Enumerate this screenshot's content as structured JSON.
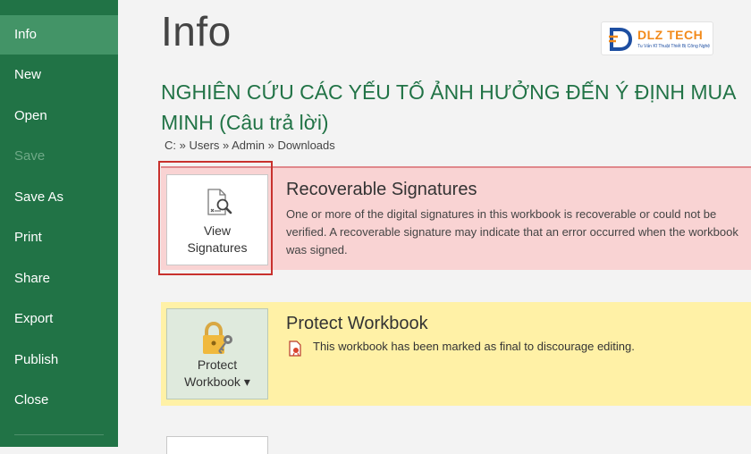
{
  "sidebar": {
    "items": [
      {
        "label": "Info"
      },
      {
        "label": "New"
      },
      {
        "label": "Open"
      },
      {
        "label": "Save"
      },
      {
        "label": "Save As"
      },
      {
        "label": "Print"
      },
      {
        "label": "Share"
      },
      {
        "label": "Export"
      },
      {
        "label": "Publish"
      },
      {
        "label": "Close"
      }
    ],
    "active_index": 0
  },
  "main": {
    "title": "Info",
    "document_title": "NGHIÊN CỨU CÁC YẾU TỐ ẢNH HƯỞNG ĐẾN Ý ĐỊNH MUA MINH (Câu trả lời)",
    "breadcrumb": "C: » Users » Admin » Downloads"
  },
  "logo": {
    "text": "DLZ TECH",
    "tagline": "Tu Vấn Kĩ Thuật Thiết Bị Công Nghệ"
  },
  "signatures_card": {
    "button_line1": "View",
    "button_line2": "Signatures",
    "heading": "Recoverable Signatures",
    "description": "One or more of the digital signatures in this workbook is recoverable or could not be verified. A recoverable signature may indicate that an error occurred when the workbook was signed."
  },
  "protect_card": {
    "button_line1": "Protect",
    "button_line2": "Workbook ▾",
    "heading": "Protect Workbook",
    "marked_final": "This workbook has been marked as final to discourage editing."
  },
  "colors": {
    "sidebar_bg": "#217346",
    "sidebar_active": "#439467",
    "title_green": "#217346",
    "signature_card_bg": "#f9d3d3",
    "protect_card_bg": "#fff1a6",
    "highlight_red": "#c8312d"
  },
  "icons": {
    "signature": "signature-magnifier-icon",
    "protect": "padlock-key-icon",
    "final": "marked-final-icon"
  }
}
